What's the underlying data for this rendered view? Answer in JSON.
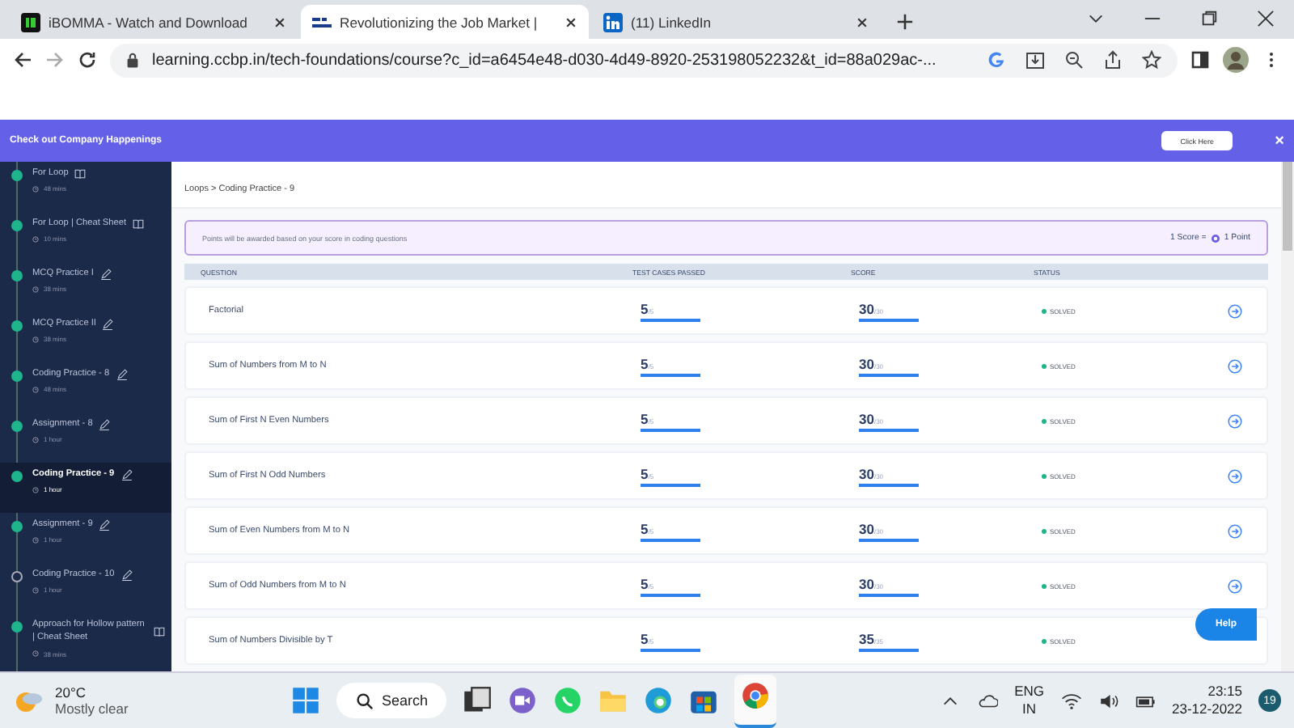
{
  "browser": {
    "tabs": [
      {
        "title": "iBOMMA - Watch and Download",
        "selected": false,
        "kind": "ib"
      },
      {
        "title": "Revolutionizing the Job Market |",
        "selected": true,
        "kind": "ccbp"
      },
      {
        "title": "(11) LinkedIn",
        "selected": false,
        "kind": "in"
      }
    ],
    "url": "learning.ccbp.in/tech-foundations/course?c_id=a6454e48-d030-4d49-8920-253198052232&t_id=88a029ac-..."
  },
  "banner": {
    "text": "Check out Company Happenings",
    "button": "Click Here",
    "close": "×"
  },
  "sidebar": {
    "items": [
      {
        "title": "For Loop",
        "duration": "48 mins",
        "kind": "book",
        "completed": true,
        "selected": false
      },
      {
        "title": "For Loop | Cheat Sheet",
        "duration": "10 mins",
        "kind": "book",
        "completed": true,
        "selected": false
      },
      {
        "title": "MCQ Practice I",
        "duration": "38 mins",
        "kind": "pencil",
        "completed": true,
        "selected": false
      },
      {
        "title": "MCQ Practice II",
        "duration": "38 mins",
        "kind": "pencil",
        "completed": true,
        "selected": false
      },
      {
        "title": "Coding Practice - 8",
        "duration": "48 mins",
        "kind": "pencil",
        "completed": true,
        "selected": false
      },
      {
        "title": "Assignment - 8",
        "duration": "1 hour",
        "kind": "pencil",
        "completed": true,
        "selected": false
      },
      {
        "title": "Coding Practice - 9",
        "duration": "1 hour",
        "kind": "pencil",
        "completed": true,
        "selected": true
      },
      {
        "title": "Assignment - 9",
        "duration": "1 hour",
        "kind": "pencil",
        "completed": true,
        "selected": false
      },
      {
        "title": "Coding Practice - 10",
        "duration": "1 hour",
        "kind": "pencil",
        "completed": false,
        "selected": false
      },
      {
        "title": "Approach for Hollow pattern | Cheat Sheet",
        "duration": "38 mins",
        "kind": "book",
        "completed": true,
        "selected": false
      }
    ]
  },
  "breadcrumb": "Loops > Coding Practice - 9",
  "info": {
    "text": "Points will be awarded based on your score in coding questions",
    "score_label": "1 Score =",
    "point_label": "1 Point"
  },
  "table": {
    "columns": [
      "QUESTION",
      "TEST CASES PASSED",
      "SCORE",
      "STATUS"
    ],
    "rows": [
      {
        "question": "Factorial",
        "tests": {
          "passed": "5",
          "total": "/5",
          "level": 1
        },
        "score": {
          "value": "30",
          "max": "/30",
          "level": 1
        },
        "status": "SOLVED"
      },
      {
        "question": "Sum of Numbers from M to N",
        "tests": {
          "passed": "5",
          "total": "/5",
          "level": 1
        },
        "score": {
          "value": "30",
          "max": "/30",
          "level": 1
        },
        "status": "SOLVED"
      },
      {
        "question": "Sum of First N Even Numbers",
        "tests": {
          "passed": "5",
          "total": "/5",
          "level": 1
        },
        "score": {
          "value": "30",
          "max": "/30",
          "level": 1
        },
        "status": "SOLVED"
      },
      {
        "question": "Sum of First N Odd Numbers",
        "tests": {
          "passed": "5",
          "total": "/5",
          "level": 1
        },
        "score": {
          "value": "30",
          "max": "/30",
          "level": 1
        },
        "status": "SOLVED"
      },
      {
        "question": "Sum of Even Numbers from M to N",
        "tests": {
          "passed": "5",
          "total": "/5",
          "level": 1
        },
        "score": {
          "value": "30",
          "max": "/30",
          "level": 1
        },
        "status": "SOLVED"
      },
      {
        "question": "Sum of Odd Numbers from M to N",
        "tests": {
          "passed": "5",
          "total": "/5",
          "level": 1
        },
        "score": {
          "value": "30",
          "max": "/30",
          "level": 1
        },
        "status": "SOLVED"
      },
      {
        "question": "Sum of Numbers Divisible by T",
        "tests": {
          "passed": "5",
          "total": "/5",
          "level": 1
        },
        "score": {
          "value": "35",
          "max": "/35",
          "level": 1
        },
        "status": "SOLVED"
      }
    ]
  },
  "help_button": "Help",
  "taskbar": {
    "temperature": "20°C",
    "weather": "Mostly clear",
    "search": "Search",
    "language": "ENG",
    "region": "IN",
    "time": "23:15",
    "date": "23-12-2022",
    "notifications": "19"
  }
}
